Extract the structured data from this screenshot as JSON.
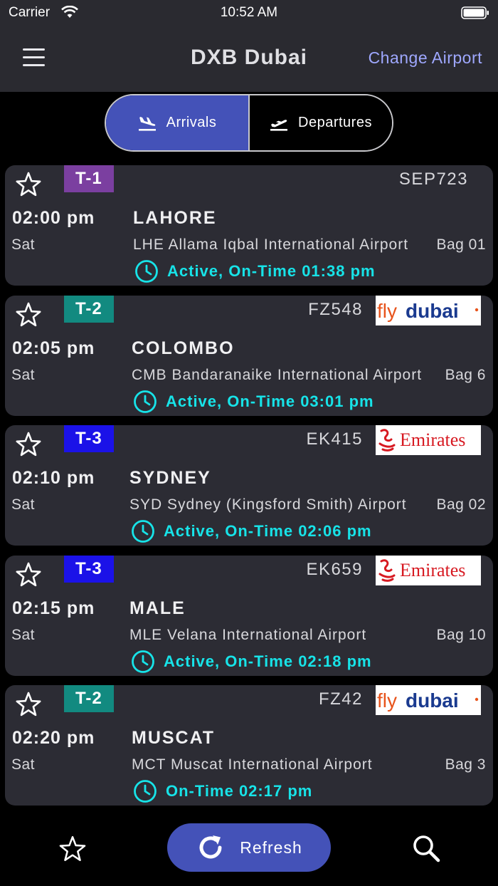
{
  "status_bar": {
    "carrier": "Carrier",
    "time": "10:52 AM"
  },
  "header": {
    "title": "DXB Dubai",
    "change_airport": "Change Airport"
  },
  "tabs": [
    {
      "label": "Arrivals",
      "selected": true,
      "icon": "plane-landing-icon"
    },
    {
      "label": "Departures",
      "selected": false,
      "icon": "plane-takeoff-icon"
    }
  ],
  "colors": {
    "accent": "#4452b8",
    "status_cyan": "#17e3e8",
    "terminal_t1": "#7b3fa0",
    "terminal_t2": "#128a80",
    "terminal_t3": "#1b12e8"
  },
  "flights": [
    {
      "terminal": "T-1",
      "terminal_color": "#7b3fa0",
      "flight_no": "SEP723",
      "airline_logo": "",
      "time": "02:00 pm",
      "day": "Sat",
      "city": "LAHORE",
      "airport": "LHE Allama Iqbal International Airport",
      "bag": "Bag 01",
      "status": "Active, On-Time 01:38 pm"
    },
    {
      "terminal": "T-2",
      "terminal_color": "#128a80",
      "flight_no": "FZ548",
      "airline_logo": "flydubai",
      "time": "02:05 pm",
      "day": "Sat",
      "city": "COLOMBO",
      "airport": "CMB Bandaranaike International Airport",
      "bag": "Bag 6",
      "status": "Active, On-Time 03:01 pm"
    },
    {
      "terminal": "T-3",
      "terminal_color": "#1b12e8",
      "flight_no": "EK415",
      "airline_logo": "Emirates",
      "time": "02:10 pm",
      "day": "Sat",
      "city": "SYDNEY",
      "airport": "SYD Sydney (Kingsford Smith) Airport",
      "bag": "Bag 02",
      "status": "Active, On-Time 02:06 pm"
    },
    {
      "terminal": "T-3",
      "terminal_color": "#1b12e8",
      "flight_no": "EK659",
      "airline_logo": "Emirates",
      "time": "02:15 pm",
      "day": "Sat",
      "city": "MALE",
      "airport": "MLE Velana International Airport",
      "bag": "Bag 10",
      "status": "Active, On-Time 02:18 pm"
    },
    {
      "terminal": "T-2",
      "terminal_color": "#128a80",
      "flight_no": "FZ42",
      "airline_logo": "flydubai",
      "time": "02:20 pm",
      "day": "Sat",
      "city": "MUSCAT",
      "airport": "MCT Muscat International Airport",
      "bag": "Bag 3",
      "status": "On-Time 02:17 pm"
    }
  ],
  "bottom_bar": {
    "refresh_label": "Refresh"
  }
}
